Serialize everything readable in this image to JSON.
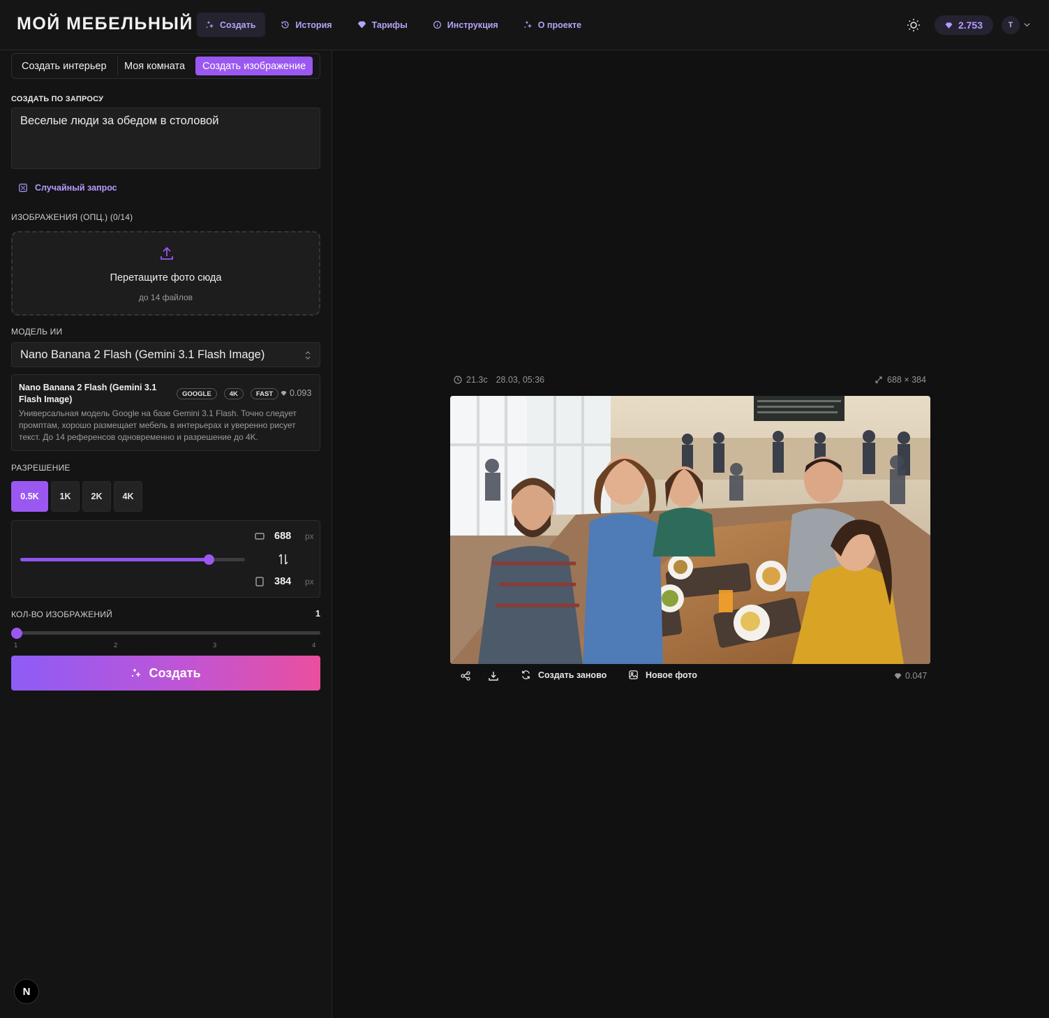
{
  "brand": "МОЙ МЕБЕЛЬНЫЙ",
  "nav": [
    {
      "label": "Создать",
      "icon": "sparkles-icon",
      "active": true
    },
    {
      "label": "История",
      "icon": "history-icon"
    },
    {
      "label": "Тарифы",
      "icon": "gem-icon"
    },
    {
      "label": "Инструкция",
      "icon": "info-icon"
    },
    {
      "label": "О проекте",
      "icon": "sparkles-icon"
    }
  ],
  "header": {
    "balance": "2.753",
    "avatar": "T",
    "theme_icon": "sun-icon"
  },
  "tabs": [
    "Создать интерьер",
    "Моя комната",
    "Создать изображение"
  ],
  "prompt": {
    "label": "СОЗДАТЬ ПО ЗАПРОСУ",
    "value": "Веселые люди за обедом в столовой"
  },
  "random_prompt": "Случайный запрос",
  "images": {
    "label": "ИЗОБРАЖЕНИЯ (ОПЦ.) (0/14)",
    "drop_title": "Перетащите фото сюда",
    "drop_sub": "до 14 файлов"
  },
  "model": {
    "label": "МОДЕЛЬ ИИ",
    "selected": "Nano Banana 2 Flash (Gemini 3.1 Flash Image)",
    "card_name": "Nano Banana 2 Flash (Gemini 3.1 Flash Image)",
    "badges": [
      "GOOGLE",
      "4K",
      "FAST"
    ],
    "price": "0.093",
    "description": "Универсальная модель Google на базе Gemini 3.1 Flash. Точно следует промптам, хорошо размещает мебель в интерьерах и уверенно рисует текст. До 14 референсов одновременно и разрешение до 4K."
  },
  "resolution": {
    "label": "РАЗРЕШЕНИЕ",
    "options": [
      "0.5K",
      "1K",
      "2K",
      "4K"
    ],
    "selected": "0.5K",
    "width": "688",
    "height": "384",
    "unit": "px",
    "slider_fraction": 0.84
  },
  "count": {
    "label": "КОЛ-ВО ИЗОБРАЖЕНИЙ",
    "value": "1",
    "ticks": [
      "1",
      "2",
      "3",
      "4"
    ],
    "min": 1,
    "max": 4
  },
  "create_button": "Создать",
  "result": {
    "duration": "21.3с",
    "timestamp": "28.03, 05:36",
    "dimensions": "688 × 384",
    "regenerate": "Создать заново",
    "new_photo": "Новое фото",
    "cost": "0.047"
  },
  "colors": {
    "accent": "#9a58f1",
    "accent_text": "#b49cff",
    "gradient_start": "#8d5cf6",
    "gradient_end": "#ea4f9e",
    "background": "#111112"
  }
}
